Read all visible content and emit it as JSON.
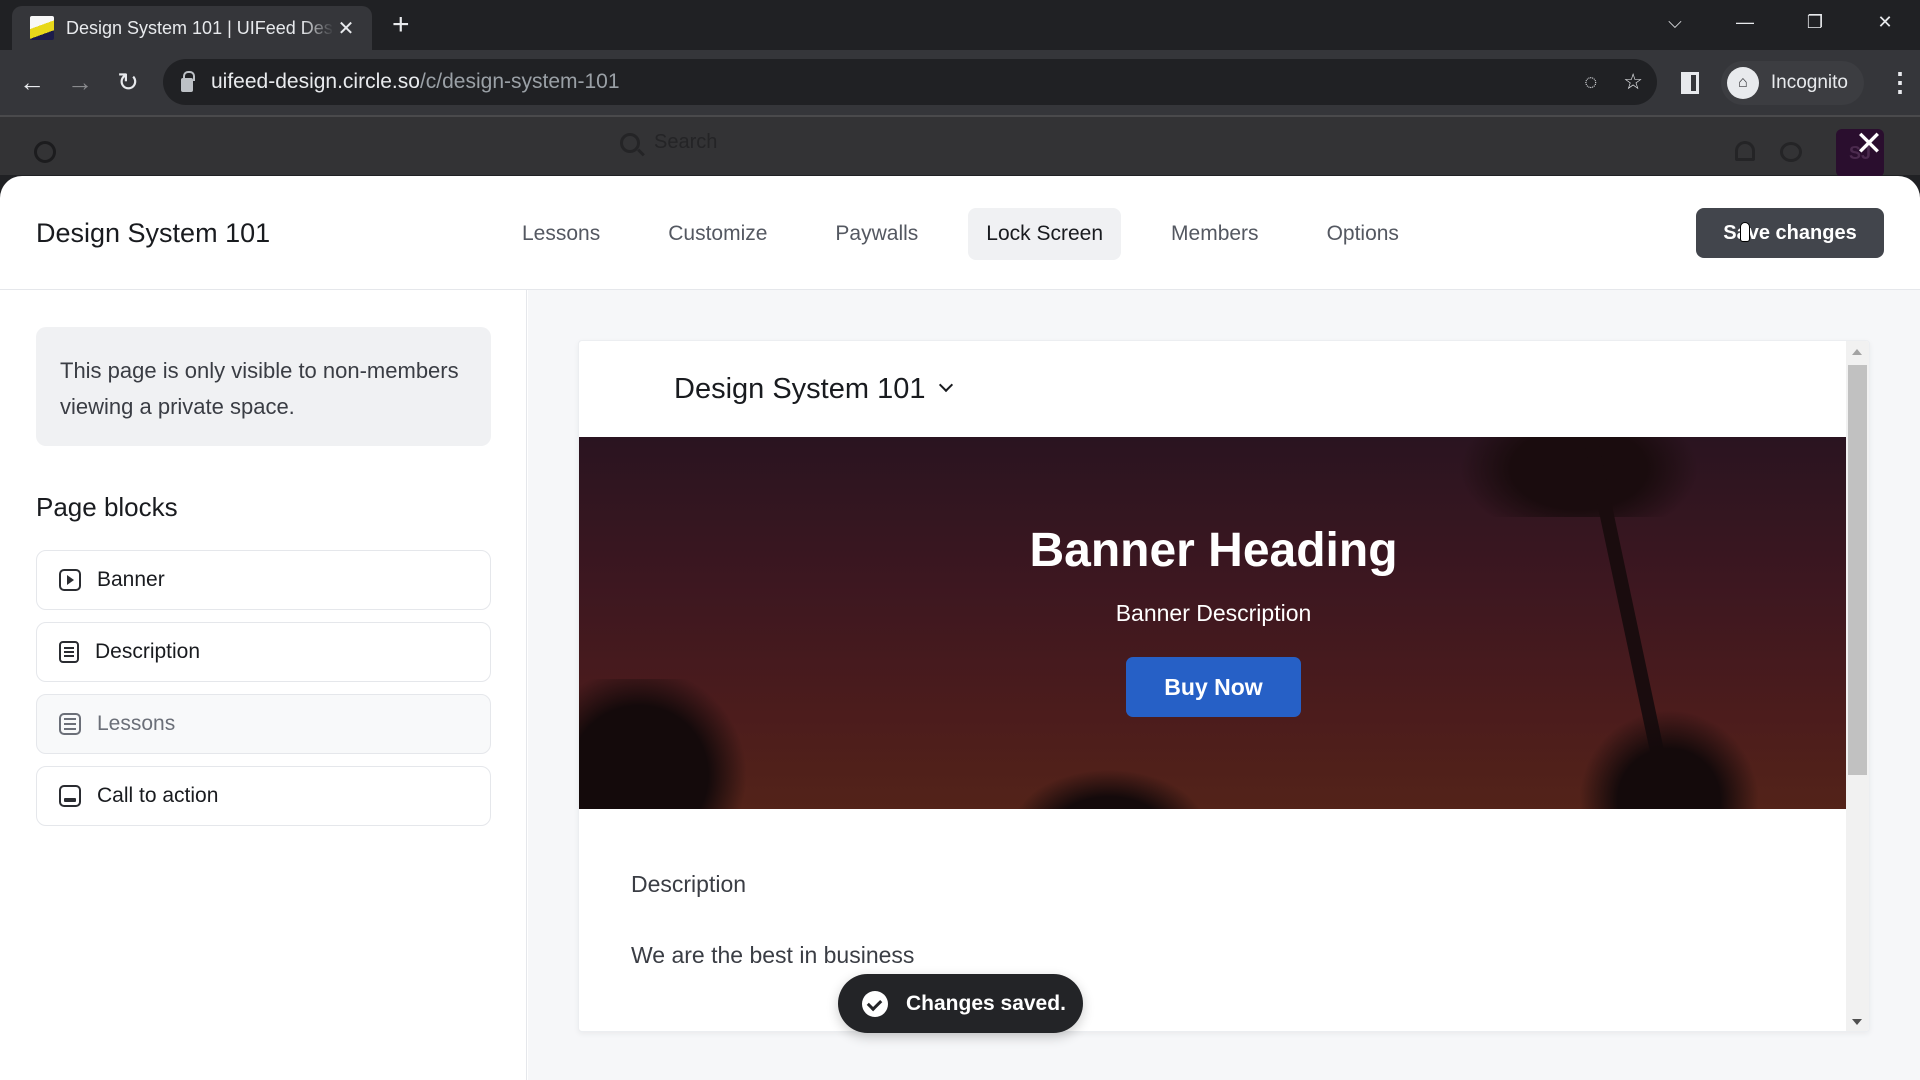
{
  "browser": {
    "tab_title": "Design System 101 | UIFeed Design",
    "tab_close": "✕",
    "new_tab": "+",
    "url_host": "uifeed-design.circle.so",
    "url_path": "/c/design-system-101",
    "profile_label": "Incognito",
    "window_controls": {
      "dropdown": "⌵",
      "minimize": "—",
      "restore": "❐",
      "close": "✕"
    },
    "nav": {
      "back": "←",
      "forward": "→",
      "reload": "↻"
    },
    "omni_icons": {
      "eye_off": "◌",
      "star": "☆"
    },
    "menu": "⋮"
  },
  "site_header": {
    "search_placeholder": "Search",
    "avatar_initials": "SJ"
  },
  "modal": {
    "close": "✕",
    "space_title": "Design System 101",
    "tabs": [
      {
        "label": "Lessons",
        "active": false
      },
      {
        "label": "Customize",
        "active": false
      },
      {
        "label": "Paywalls",
        "active": false
      },
      {
        "label": "Lock Screen",
        "active": true
      },
      {
        "label": "Members",
        "active": false
      },
      {
        "label": "Options",
        "active": false
      }
    ],
    "save_label": "Save changes"
  },
  "left_panel": {
    "notice": "This page is only visible to non-members viewing a private space.",
    "blocks_title": "Page blocks",
    "blocks": [
      {
        "label": "Banner",
        "icon": "play-square-icon",
        "disabled": false
      },
      {
        "label": "Description",
        "icon": "document-icon",
        "disabled": false
      },
      {
        "label": "Lessons",
        "icon": "list-icon",
        "disabled": true
      },
      {
        "label": "Call to action",
        "icon": "cta-icon",
        "disabled": false
      }
    ]
  },
  "preview": {
    "title": "Design System 101",
    "banner": {
      "heading": "Banner Heading",
      "description": "Banner Description",
      "button": "Buy Now",
      "button_color": "#2660c6"
    },
    "description_title": "Description",
    "description_text": "We are the best in business"
  },
  "toast": {
    "text": "Changes saved."
  }
}
